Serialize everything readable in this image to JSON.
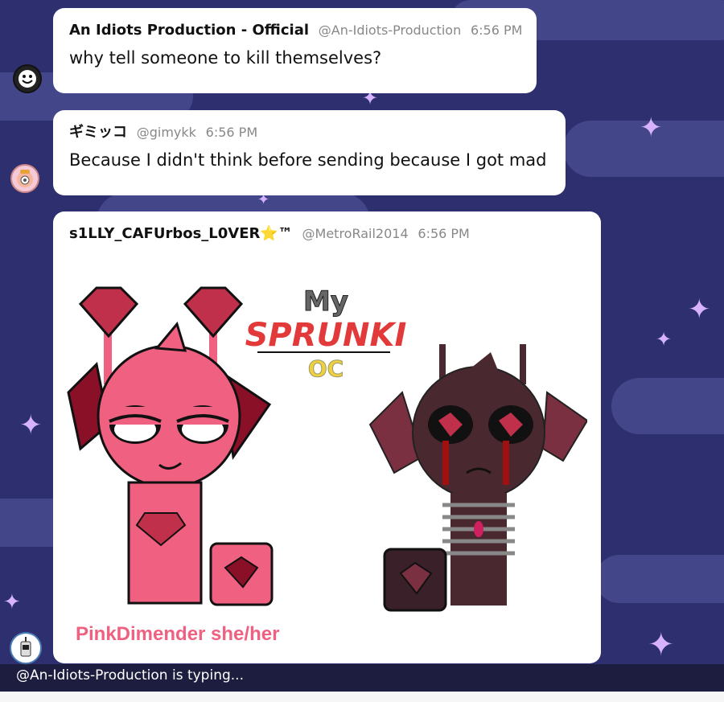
{
  "messages": [
    {
      "name": "An Idiots Production - Official",
      "handle": "@An-Idiots-Production",
      "time": "6:56 PM",
      "text": "why tell someone to kill themselves?"
    },
    {
      "name": "ギミッコ",
      "handle": "@gimykk",
      "time": "6:56 PM",
      "text": "Because I didn't think before sending because I got mad"
    },
    {
      "name": "s1LLY_CAFUrbos_L0VER⭐™",
      "handle": "@MetroRail2014",
      "time": "6:56 PM",
      "image": {
        "title_my": "My",
        "title_sprunki": "SPRUNKI",
        "title_oc": "OC",
        "caption": "PinkDimender she/her",
        "colors": {
          "pink": "#f06080",
          "pink_dark": "#c0304a",
          "gem_dark": "#8a1028",
          "dark_char": "#4a2830",
          "blood": "#a01010"
        }
      }
    }
  ],
  "typing_text": "@An-Idiots-Production is typing..."
}
